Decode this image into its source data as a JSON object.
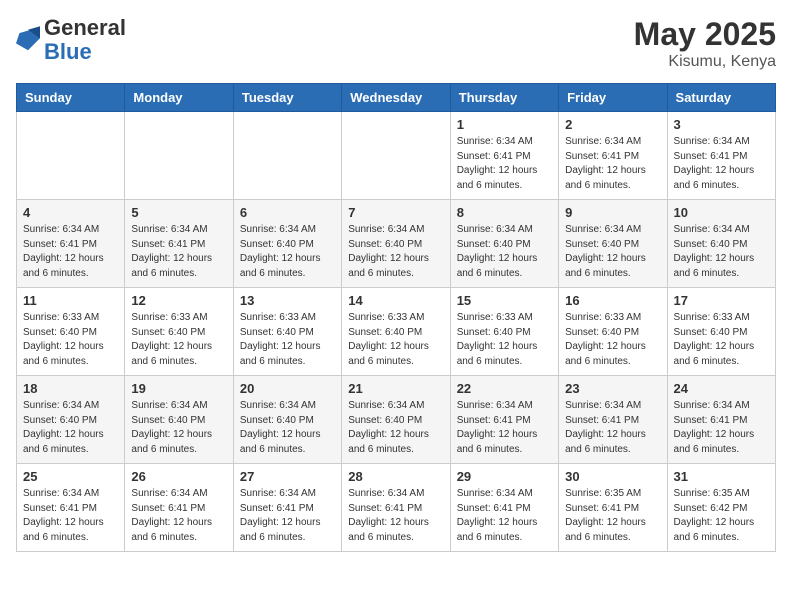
{
  "header": {
    "logo_general": "General",
    "logo_blue": "Blue",
    "month_year": "May 2025",
    "location": "Kisumu, Kenya"
  },
  "days_of_week": [
    "Sunday",
    "Monday",
    "Tuesday",
    "Wednesday",
    "Thursday",
    "Friday",
    "Saturday"
  ],
  "weeks": [
    [
      {
        "day": "",
        "info": ""
      },
      {
        "day": "",
        "info": ""
      },
      {
        "day": "",
        "info": ""
      },
      {
        "day": "",
        "info": ""
      },
      {
        "day": "1",
        "info": "Sunrise: 6:34 AM\nSunset: 6:41 PM\nDaylight: 12 hours\nand 6 minutes."
      },
      {
        "day": "2",
        "info": "Sunrise: 6:34 AM\nSunset: 6:41 PM\nDaylight: 12 hours\nand 6 minutes."
      },
      {
        "day": "3",
        "info": "Sunrise: 6:34 AM\nSunset: 6:41 PM\nDaylight: 12 hours\nand 6 minutes."
      }
    ],
    [
      {
        "day": "4",
        "info": "Sunrise: 6:34 AM\nSunset: 6:41 PM\nDaylight: 12 hours\nand 6 minutes."
      },
      {
        "day": "5",
        "info": "Sunrise: 6:34 AM\nSunset: 6:41 PM\nDaylight: 12 hours\nand 6 minutes."
      },
      {
        "day": "6",
        "info": "Sunrise: 6:34 AM\nSunset: 6:40 PM\nDaylight: 12 hours\nand 6 minutes."
      },
      {
        "day": "7",
        "info": "Sunrise: 6:34 AM\nSunset: 6:40 PM\nDaylight: 12 hours\nand 6 minutes."
      },
      {
        "day": "8",
        "info": "Sunrise: 6:34 AM\nSunset: 6:40 PM\nDaylight: 12 hours\nand 6 minutes."
      },
      {
        "day": "9",
        "info": "Sunrise: 6:34 AM\nSunset: 6:40 PM\nDaylight: 12 hours\nand 6 minutes."
      },
      {
        "day": "10",
        "info": "Sunrise: 6:34 AM\nSunset: 6:40 PM\nDaylight: 12 hours\nand 6 minutes."
      }
    ],
    [
      {
        "day": "11",
        "info": "Sunrise: 6:33 AM\nSunset: 6:40 PM\nDaylight: 12 hours\nand 6 minutes."
      },
      {
        "day": "12",
        "info": "Sunrise: 6:33 AM\nSunset: 6:40 PM\nDaylight: 12 hours\nand 6 minutes."
      },
      {
        "day": "13",
        "info": "Sunrise: 6:33 AM\nSunset: 6:40 PM\nDaylight: 12 hours\nand 6 minutes."
      },
      {
        "day": "14",
        "info": "Sunrise: 6:33 AM\nSunset: 6:40 PM\nDaylight: 12 hours\nand 6 minutes."
      },
      {
        "day": "15",
        "info": "Sunrise: 6:33 AM\nSunset: 6:40 PM\nDaylight: 12 hours\nand 6 minutes."
      },
      {
        "day": "16",
        "info": "Sunrise: 6:33 AM\nSunset: 6:40 PM\nDaylight: 12 hours\nand 6 minutes."
      },
      {
        "day": "17",
        "info": "Sunrise: 6:33 AM\nSunset: 6:40 PM\nDaylight: 12 hours\nand 6 minutes."
      }
    ],
    [
      {
        "day": "18",
        "info": "Sunrise: 6:34 AM\nSunset: 6:40 PM\nDaylight: 12 hours\nand 6 minutes."
      },
      {
        "day": "19",
        "info": "Sunrise: 6:34 AM\nSunset: 6:40 PM\nDaylight: 12 hours\nand 6 minutes."
      },
      {
        "day": "20",
        "info": "Sunrise: 6:34 AM\nSunset: 6:40 PM\nDaylight: 12 hours\nand 6 minutes."
      },
      {
        "day": "21",
        "info": "Sunrise: 6:34 AM\nSunset: 6:40 PM\nDaylight: 12 hours\nand 6 minutes."
      },
      {
        "day": "22",
        "info": "Sunrise: 6:34 AM\nSunset: 6:41 PM\nDaylight: 12 hours\nand 6 minutes."
      },
      {
        "day": "23",
        "info": "Sunrise: 6:34 AM\nSunset: 6:41 PM\nDaylight: 12 hours\nand 6 minutes."
      },
      {
        "day": "24",
        "info": "Sunrise: 6:34 AM\nSunset: 6:41 PM\nDaylight: 12 hours\nand 6 minutes."
      }
    ],
    [
      {
        "day": "25",
        "info": "Sunrise: 6:34 AM\nSunset: 6:41 PM\nDaylight: 12 hours\nand 6 minutes."
      },
      {
        "day": "26",
        "info": "Sunrise: 6:34 AM\nSunset: 6:41 PM\nDaylight: 12 hours\nand 6 minutes."
      },
      {
        "day": "27",
        "info": "Sunrise: 6:34 AM\nSunset: 6:41 PM\nDaylight: 12 hours\nand 6 minutes."
      },
      {
        "day": "28",
        "info": "Sunrise: 6:34 AM\nSunset: 6:41 PM\nDaylight: 12 hours\nand 6 minutes."
      },
      {
        "day": "29",
        "info": "Sunrise: 6:34 AM\nSunset: 6:41 PM\nDaylight: 12 hours\nand 6 minutes."
      },
      {
        "day": "30",
        "info": "Sunrise: 6:35 AM\nSunset: 6:41 PM\nDaylight: 12 hours\nand 6 minutes."
      },
      {
        "day": "31",
        "info": "Sunrise: 6:35 AM\nSunset: 6:42 PM\nDaylight: 12 hours\nand 6 minutes."
      }
    ]
  ]
}
